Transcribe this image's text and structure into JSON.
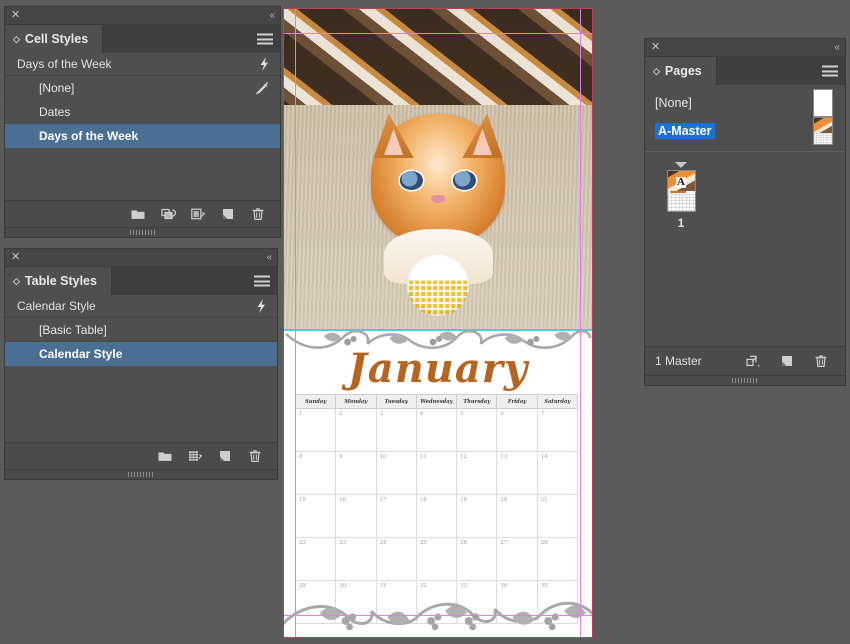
{
  "app": {
    "workspace_bg": "#5b5b5b",
    "panel_bg": "#4f4f4f",
    "selection_blue": "#4a6f92",
    "rename_blue": "#1a72d8"
  },
  "cell_styles_panel": {
    "close_label": "✕",
    "collapse_label": "«",
    "tab_label": "Cell Styles",
    "tab_diamond": "◇",
    "applied_style": "Days of the Week",
    "quick_apply_icon": "lightning-bolt-icon",
    "items": [
      {
        "label": "[None]",
        "selected": false,
        "has_brush_icon": true
      },
      {
        "label": "Dates",
        "selected": false,
        "has_brush_icon": false
      },
      {
        "label": "Days of the Week",
        "selected": true,
        "has_brush_icon": false
      }
    ],
    "footer_icons": [
      "new-style-group-folder-icon",
      "clear-overrides-icon",
      "break-link-to-style-icon",
      "create-new-style-icon",
      "delete-style-icon"
    ]
  },
  "table_styles_panel": {
    "close_label": "✕",
    "collapse_label": "«",
    "tab_label": "Table Styles",
    "tab_diamond": "◇",
    "applied_style": "Calendar Style",
    "quick_apply_icon": "lightning-bolt-icon",
    "items": [
      {
        "label": "[Basic Table]",
        "selected": false
      },
      {
        "label": "Calendar Style",
        "selected": true
      }
    ],
    "footer_icons": [
      "new-style-group-folder-icon",
      "clear-table-overrides-icon",
      "create-new-style-icon",
      "delete-style-icon"
    ]
  },
  "pages_panel": {
    "close_label": "✕",
    "collapse_label": "«",
    "tab_label": "Pages",
    "tab_diamond": "◇",
    "masters": [
      {
        "label": "[None]",
        "renaming": false,
        "thumb": "blank"
      },
      {
        "label": "A-Master",
        "renaming": true,
        "thumb": "calendar"
      }
    ],
    "pages": [
      {
        "number": "1",
        "thumb": "calendar-with-A",
        "master_letter": "A"
      }
    ],
    "footer_count": "1 Master",
    "footer_icons": [
      "edit-page-size-icon",
      "create-new-page-icon",
      "delete-page-icon"
    ]
  },
  "document": {
    "month_title": "January",
    "weekday_headers": [
      "Sunday",
      "Monday",
      "Tuesday",
      "Wednesday",
      "Thursday",
      "Friday",
      "Saturday"
    ],
    "calendar_cells": [
      [
        "1",
        "2",
        "3",
        "4",
        "5",
        "6",
        "7"
      ],
      [
        "8",
        "9",
        "10",
        "11",
        "12",
        "13",
        "14"
      ],
      [
        "15",
        "16",
        "17",
        "18",
        "19",
        "20",
        "21"
      ],
      [
        "22",
        "23",
        "24",
        "25",
        "26",
        "27",
        "28"
      ],
      [
        "29",
        "30",
        "31",
        "32",
        "33",
        "34",
        "35"
      ]
    ],
    "photo_subject": "orange-tabby-kitten-with-ball",
    "accent_title_color": "#b5651f",
    "teal_rule_color": "#55c8d4",
    "page_border_color": "#b8405a",
    "margin_guide_color": "#d97fe8"
  }
}
